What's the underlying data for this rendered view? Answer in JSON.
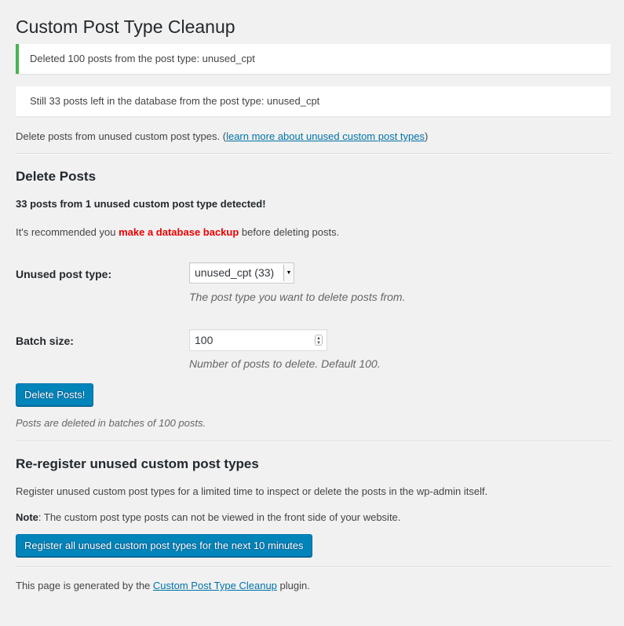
{
  "page": {
    "title": "Custom Post Type Cleanup"
  },
  "notices": {
    "success": "Deleted 100 posts from the post type: unused_cpt",
    "info": "Still 33 posts left in the database from the post type: unused_cpt"
  },
  "intro": {
    "text": "Delete posts from unused custom post types. (",
    "link": "learn more about unused custom post types",
    "close": ")"
  },
  "delete_section": {
    "heading": "Delete Posts",
    "detected": "33 posts from 1 unused custom post type detected!",
    "recommend_pre": "It's recommended you ",
    "recommend_emphasis": "make a database backup",
    "recommend_post": " before deleting posts.",
    "post_type_label": "Unused post type:",
    "post_type_value": "unused_cpt (33)",
    "post_type_desc": "The post type you want to delete posts from.",
    "batch_label": "Batch size:",
    "batch_value": "100",
    "batch_desc": "Number of posts to delete. Default 100.",
    "submit_label": "Delete Posts!",
    "batch_note": "Posts are deleted in batches of 100 posts."
  },
  "register_section": {
    "heading": "Re-register unused custom post types",
    "text": "Register unused custom post types for a limited time to inspect or delete the posts in the wp-admin itself.",
    "note_label": "Note",
    "note_text": ": The custom post type posts can not be viewed in the front side of your website.",
    "button_label": "Register all unused custom post types for the next 10 minutes"
  },
  "footer": {
    "pre": "This page is generated by the ",
    "link": "Custom Post Type Cleanup",
    "post": " plugin."
  },
  "colors": {
    "primary_button": "#0085ba",
    "success_border": "#46b450",
    "warning_text": "#ee0000",
    "link": "#0073aa"
  }
}
